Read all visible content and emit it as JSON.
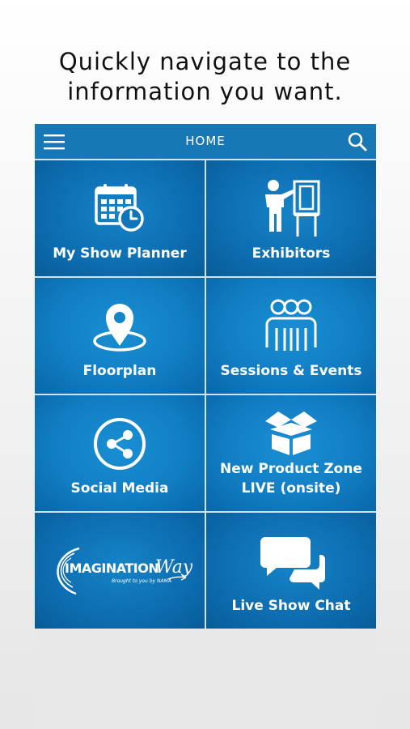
{
  "headline": {
    "line1": "Quickly navigate to the",
    "line2": "information you want."
  },
  "topbar": {
    "title": "HOME",
    "menu_icon": "hamburger-menu-icon",
    "search_icon": "search-icon"
  },
  "tiles": [
    {
      "label": "My Show Planner",
      "icon": "calendar-clock-icon"
    },
    {
      "label": "Exhibitors",
      "icon": "presenter-board-icon"
    },
    {
      "label": "Floorplan",
      "icon": "map-pin-icon"
    },
    {
      "label": "Sessions & Events",
      "icon": "people-group-icon"
    },
    {
      "label": "Social Media",
      "icon": "share-icon"
    },
    {
      "label_line1": "New Product Zone",
      "label_line2": "LIVE (onsite)",
      "icon": "open-box-icon"
    },
    {
      "logo_main": "IMAGINATION",
      "logo_script": "Way",
      "logo_sub": "Brought to you by NAMA",
      "icon": "imagination-way-logo"
    },
    {
      "label": "Live Show Chat",
      "icon": "chat-bubbles-icon"
    }
  ],
  "colors": {
    "bar": "#1877b5",
    "tile": "#117ec4",
    "tile_dark": "#0d6db0"
  }
}
